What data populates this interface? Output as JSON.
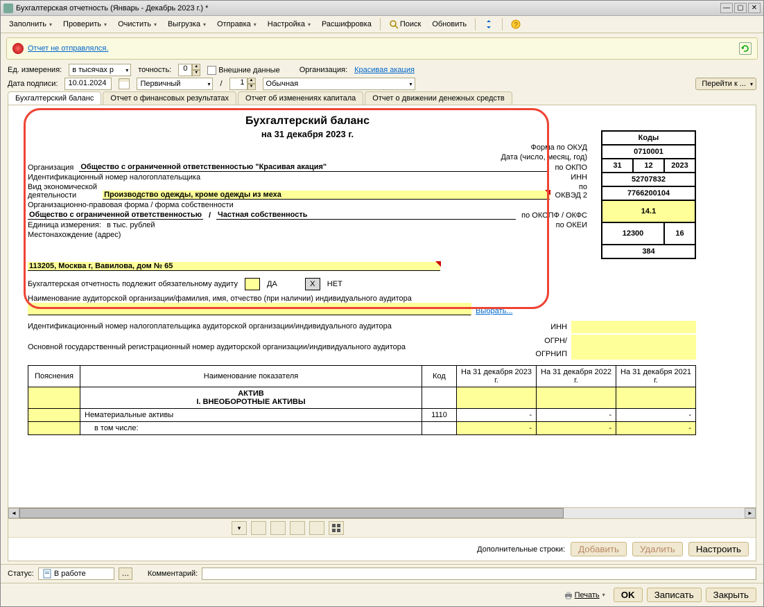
{
  "window": {
    "title": "Бухгалтерская отчетность (Январь - Декабрь 2023 г.) *"
  },
  "toolbar": {
    "fill": "Заполнить",
    "check": "Проверить",
    "clear": "Очистить",
    "export": "Выгрузка",
    "send": "Отправка",
    "settings": "Настройка",
    "decode": "Расшифровка",
    "search": "Поиск",
    "refresh": "Обновить"
  },
  "status_banner": {
    "text": "Отчет не отправлялся."
  },
  "params": {
    "unit_label": "Ед. измерения:",
    "unit_value": "в тысячах р",
    "precision_label": "точность:",
    "precision_value": "0",
    "external_data": "Внешние данные",
    "org_label": "Организация:",
    "org_link": "Красивая акация",
    "sign_date_label": "Дата подписи:",
    "sign_date": "10.01.2024",
    "type": "Первичный",
    "seq": "1",
    "kind": "Обычная",
    "goto": "Перейти к ..."
  },
  "tabs": [
    {
      "label": "Бухгалтерский баланс",
      "active": true
    },
    {
      "label": "Отчет о финансовых результатах",
      "active": false
    },
    {
      "label": "Отчет об изменениях капитала",
      "active": false
    },
    {
      "label": "Отчет о движении денежных средств",
      "active": false
    }
  ],
  "report": {
    "title": "Бухгалтерский баланс",
    "subtitle": "на 31 декабря 2023 г.",
    "form_okud_label": "Форма по ОКУД",
    "date_label": "Дата (число, месяц, год)",
    "org_label": "Организация",
    "org_value": "Общество с ограниченной ответственностью \"Красивая акация\"",
    "okpo_label": "по ОКПО",
    "inn_row_label": "Идентификационный номер налогоплательщика",
    "inn_short": "ИНН",
    "activity_label1": "Вид экономической",
    "activity_label2": "деятельности",
    "activity_value": "Производство одежды, кроме одежды из меха",
    "okved_label1": "по",
    "okved_label2": "ОКВЭД 2",
    "opf_label": "Организационно-правовая форма / форма собственности",
    "opf_val1": "Общество с ограниченной ответственностью",
    "opf_sep": "/",
    "opf_val2": "Частная собственность",
    "okopf_label": "по ОКОПФ / ОКФС",
    "unit_label": "Единица измерения:",
    "unit_value": "в тыс. рублей",
    "okei_label": "по ОКЕИ",
    "addr_label": "Местонахождение (адрес)",
    "addr_value": "113205, Москва г, Вавилова, дом № 65",
    "audit_q": "Бухгалтерская отчетность подлежит обязательному аудиту",
    "yes": "ДА",
    "no": "НЕТ",
    "auditor_name_label": "Наименование аудиторской организации/фамилия, имя, отчество (при наличии) индивидуального аудитора",
    "choose": "Выбрать...",
    "auditor_inn_label": "Идентификационный номер налогоплательщика аудиторской организации/индивидуального аудитора",
    "auditor_ogrn_label": "Основной государственный регистрационный номер аудиторской организации/индивидуального аудитора",
    "inn": "ИНН",
    "ogrn": "ОГРН/",
    "ogrnip": "ОГРНИП"
  },
  "codes": {
    "head": "Коды",
    "okud": "0710001",
    "date_d": "31",
    "date_m": "12",
    "date_y": "2023",
    "okpo": "52707832",
    "inn": "7766200104",
    "okved": "14.1",
    "okopf": "12300",
    "okfs": "16",
    "okei": "384"
  },
  "table": {
    "h_notes": "Пояснения",
    "h_name": "Наименование показателя",
    "h_code": "Код",
    "h_y1": "На 31 декабря 2023 г.",
    "h_y2": "На 31 декабря 2022 г.",
    "h_y3": "На 31 декабря 2021 г.",
    "r_aktiv": "АКТИВ",
    "r_sec1": "I. ВНЕОБОРОТНЫЕ АКТИВЫ",
    "r_intang": "Нематериальные активы",
    "r_intang_code": "1110",
    "r_incl": "в том числе:",
    "dash": "-"
  },
  "bottom": {
    "extra_rows": "Дополнительные строки:",
    "add": "Добавить",
    "del": "Удалить",
    "tune": "Настроить"
  },
  "statusbar": {
    "status_label": "Статус:",
    "status_value": "В работе",
    "comment_label": "Комментарий:"
  },
  "footer": {
    "print": "Печать",
    "ok": "OK",
    "save": "Записать",
    "close": "Закрыть"
  }
}
